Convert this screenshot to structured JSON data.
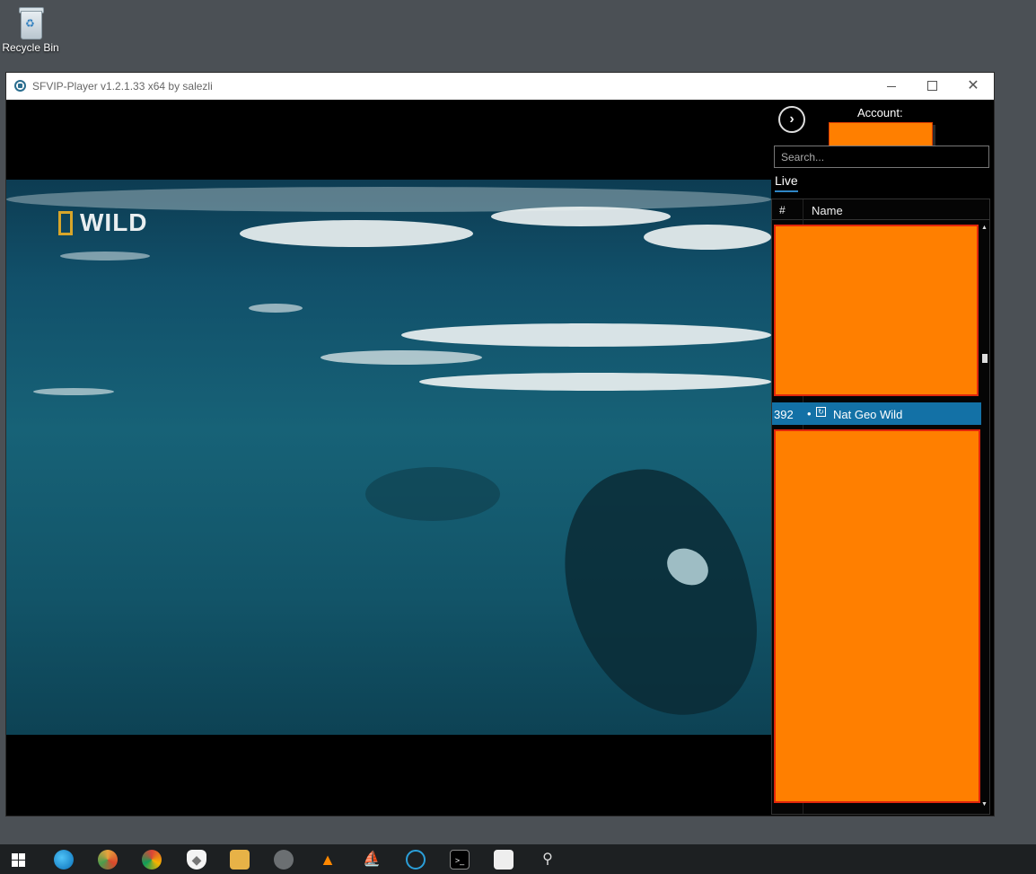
{
  "desktop": {
    "recycle_bin_label": "Recycle Bin"
  },
  "window": {
    "title": "SFVIP-Player v1.2.1.33 x64 by salezli",
    "controls": {
      "minimize": "minimize",
      "maximize": "maximize",
      "close": "✕"
    }
  },
  "video": {
    "channel_logo_text": "WILD",
    "logo_accent": "#d8a62a"
  },
  "panel": {
    "nav_button": "›",
    "account_label": "Account:",
    "account_value_redacted": true,
    "search_placeholder": "Search...",
    "tabs": [
      {
        "label": "Live",
        "active": true
      }
    ],
    "list": {
      "columns": [
        "#",
        "Name"
      ],
      "selected_row": {
        "number": "392",
        "bullet": "•",
        "icon": "tv-channel-icon",
        "name": "Nat Geo Wild"
      }
    }
  },
  "colors": {
    "accent_blue": "#1371a6",
    "redaction": "#ff7f00",
    "desktop": "#4b5055",
    "taskbar": "#1d2022"
  },
  "taskbar": {
    "icons": [
      "windows-start-icon",
      "edge-browser-icon",
      "chrome-canary-icon",
      "chrome-icon",
      "brave-browser-icon",
      "file-explorer-icon",
      "media-app-icon",
      "vlc-icon",
      "boat-app-icon",
      "sfvip-player-icon",
      "terminal-icon",
      "task-manager-icon",
      "search-magnifier-icon"
    ]
  }
}
